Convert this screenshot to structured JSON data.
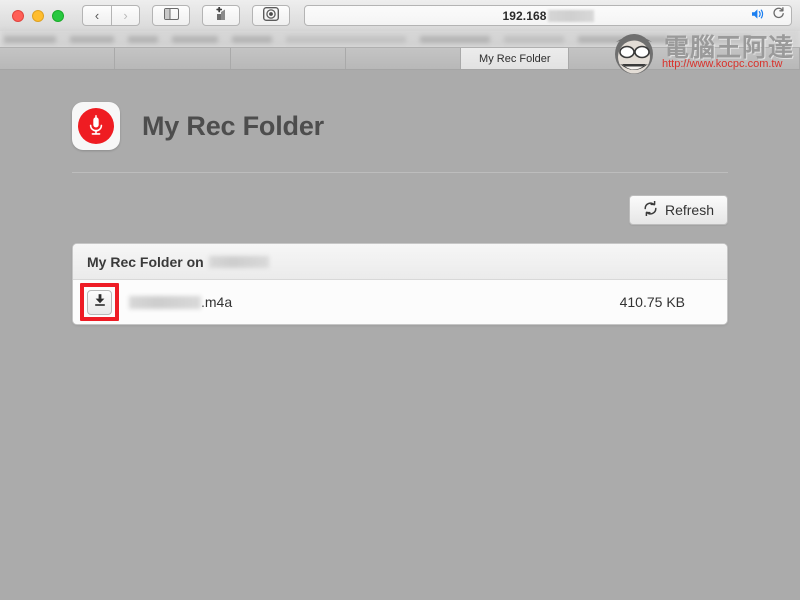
{
  "browser": {
    "window_controls": [
      "close",
      "minimize",
      "maximize"
    ],
    "nav": {
      "back_label": "‹",
      "forward_label": "›"
    },
    "buttons": {
      "sidebar": "sidebar-icon",
      "add_bookmark": "add-bookmark-icon",
      "camera": "camera-icon",
      "audio": "speaker-icon",
      "reload": "reload-icon"
    },
    "url": {
      "value": "192.168",
      "redacted": true
    },
    "bookmarks_redacted_count": 9,
    "tabs": [
      {
        "label": "My Rec Folder",
        "active": true
      }
    ]
  },
  "watermark": {
    "title": "電腦王阿達",
    "url": "http://www.kocpc.com.tw"
  },
  "page": {
    "app_icon": "microphone-icon",
    "title": "My Rec Folder",
    "refresh_button": "Refresh",
    "refresh_icon": "refresh-icon",
    "panel": {
      "header_prefix": "My Rec Folder on",
      "header_host_redacted": true,
      "files": [
        {
          "download_icon": "download-icon",
          "name_redacted": true,
          "extension": ".m4a",
          "size": "410.75 KB",
          "highlighted": true
        }
      ]
    }
  }
}
